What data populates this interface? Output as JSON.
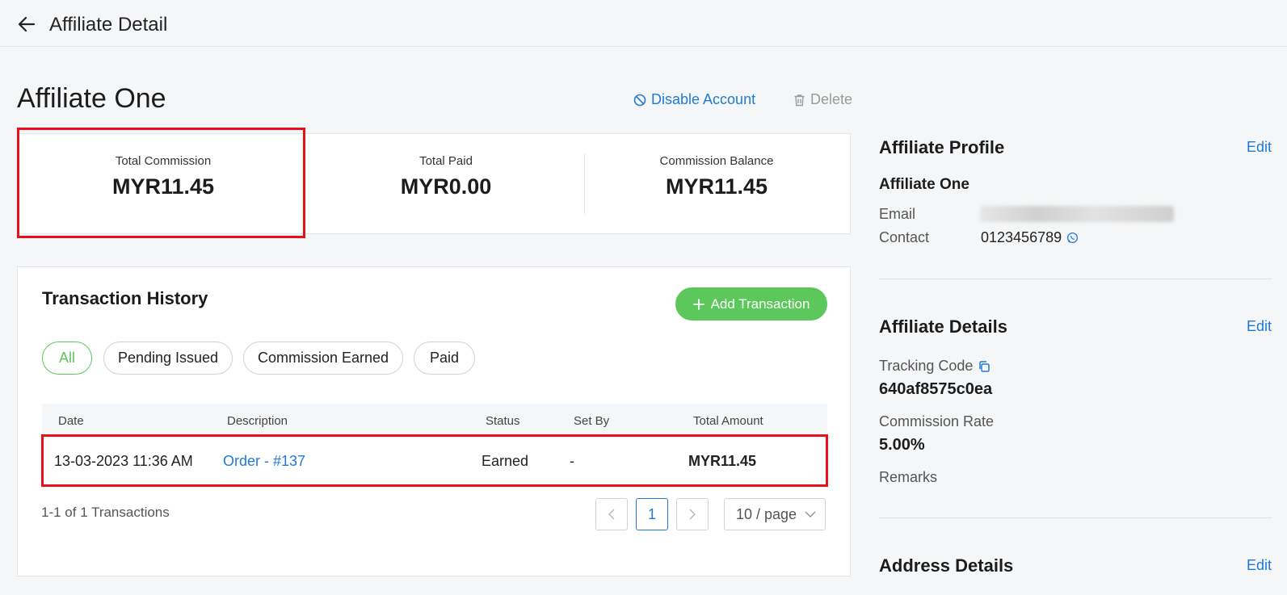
{
  "header": {
    "title": "Affiliate Detail"
  },
  "page": {
    "title": "Affiliate One",
    "disable_label": "Disable Account",
    "delete_label": "Delete"
  },
  "summary": {
    "total_commission": {
      "label": "Total Commission",
      "value": "MYR11.45"
    },
    "total_paid": {
      "label": "Total Paid",
      "value": "MYR0.00"
    },
    "commission_balance": {
      "label": "Commission Balance",
      "value": "MYR11.45"
    }
  },
  "transactions": {
    "title": "Transaction History",
    "add_label": "Add Transaction",
    "filters": [
      "All",
      "Pending Issued",
      "Commission Earned",
      "Paid"
    ],
    "active_filter": "All",
    "columns": [
      "Date",
      "Description",
      "Status",
      "Set By",
      "Total Amount"
    ],
    "rows": [
      {
        "date": "13-03-2023 11:36 AM",
        "description": "Order - #137",
        "status": "Earned",
        "set_by": "-",
        "amount": "MYR11.45"
      }
    ],
    "count_text": "1-1 of 1 Transactions",
    "current_page": "1",
    "page_size": "10 / page"
  },
  "profile": {
    "title": "Affiliate Profile",
    "edit_label": "Edit",
    "name": "Affiliate One",
    "email_label": "Email",
    "contact_label": "Contact",
    "contact_value": "0123456789"
  },
  "details": {
    "title": "Affiliate Details",
    "edit_label": "Edit",
    "tracking_code_label": "Tracking Code",
    "tracking_code_value": "640af8575c0ea",
    "commission_rate_label": "Commission Rate",
    "commission_rate_value": "5.00%",
    "remarks_label": "Remarks"
  },
  "address": {
    "title": "Address Details",
    "edit_label": "Edit"
  },
  "colors": {
    "accent_blue": "#1f7ad6",
    "accent_green": "#5cc85c",
    "highlight_red": "#e8101a"
  },
  "icons": {
    "back": "arrow-left-icon",
    "disable": "ban-icon",
    "delete": "trash-icon",
    "add": "plus-icon",
    "whatsapp": "whatsapp-icon",
    "copy": "copy-icon",
    "prev": "chevron-left-icon",
    "next": "chevron-right-icon",
    "dropdown": "chevron-down-icon"
  }
}
